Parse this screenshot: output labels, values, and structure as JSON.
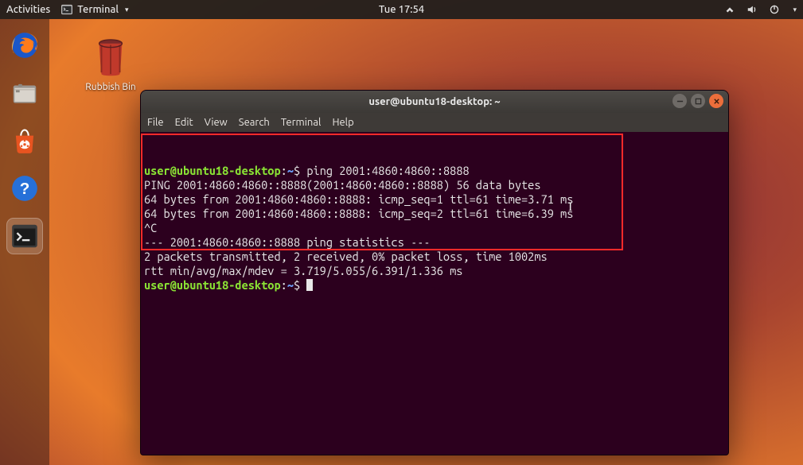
{
  "topbar": {
    "activities": "Activities",
    "app_label": "Terminal",
    "clock": "Tue 17:54"
  },
  "desktop": {
    "trash_label": "Rubbish Bin"
  },
  "dock": {
    "items": [
      "firefox",
      "files",
      "software",
      "help",
      "terminal"
    ]
  },
  "terminal": {
    "title": "user@ubuntu18-desktop: ~",
    "menus": [
      "File",
      "Edit",
      "View",
      "Search",
      "Terminal",
      "Help"
    ],
    "prompt": {
      "user_host": "user@ubuntu18-desktop",
      "path": "~",
      "symbol": "$"
    },
    "command": "ping 2001:4860:4860::8888",
    "output": [
      "PING 2001:4860:4860::8888(2001:4860:4860::8888) 56 data bytes",
      "64 bytes from 2001:4860:4860::8888: icmp_seq=1 ttl=61 time=3.71 ms",
      "64 bytes from 2001:4860:4860::8888: icmp_seq=2 ttl=61 time=6.39 ms",
      "^C",
      "--- 2001:4860:4860::8888 ping statistics ---",
      "2 packets transmitted, 2 received, 0% packet loss, time 1002ms",
      "rtt min/avg/max/mdev = 3.719/5.055/6.391/1.336 ms"
    ]
  }
}
